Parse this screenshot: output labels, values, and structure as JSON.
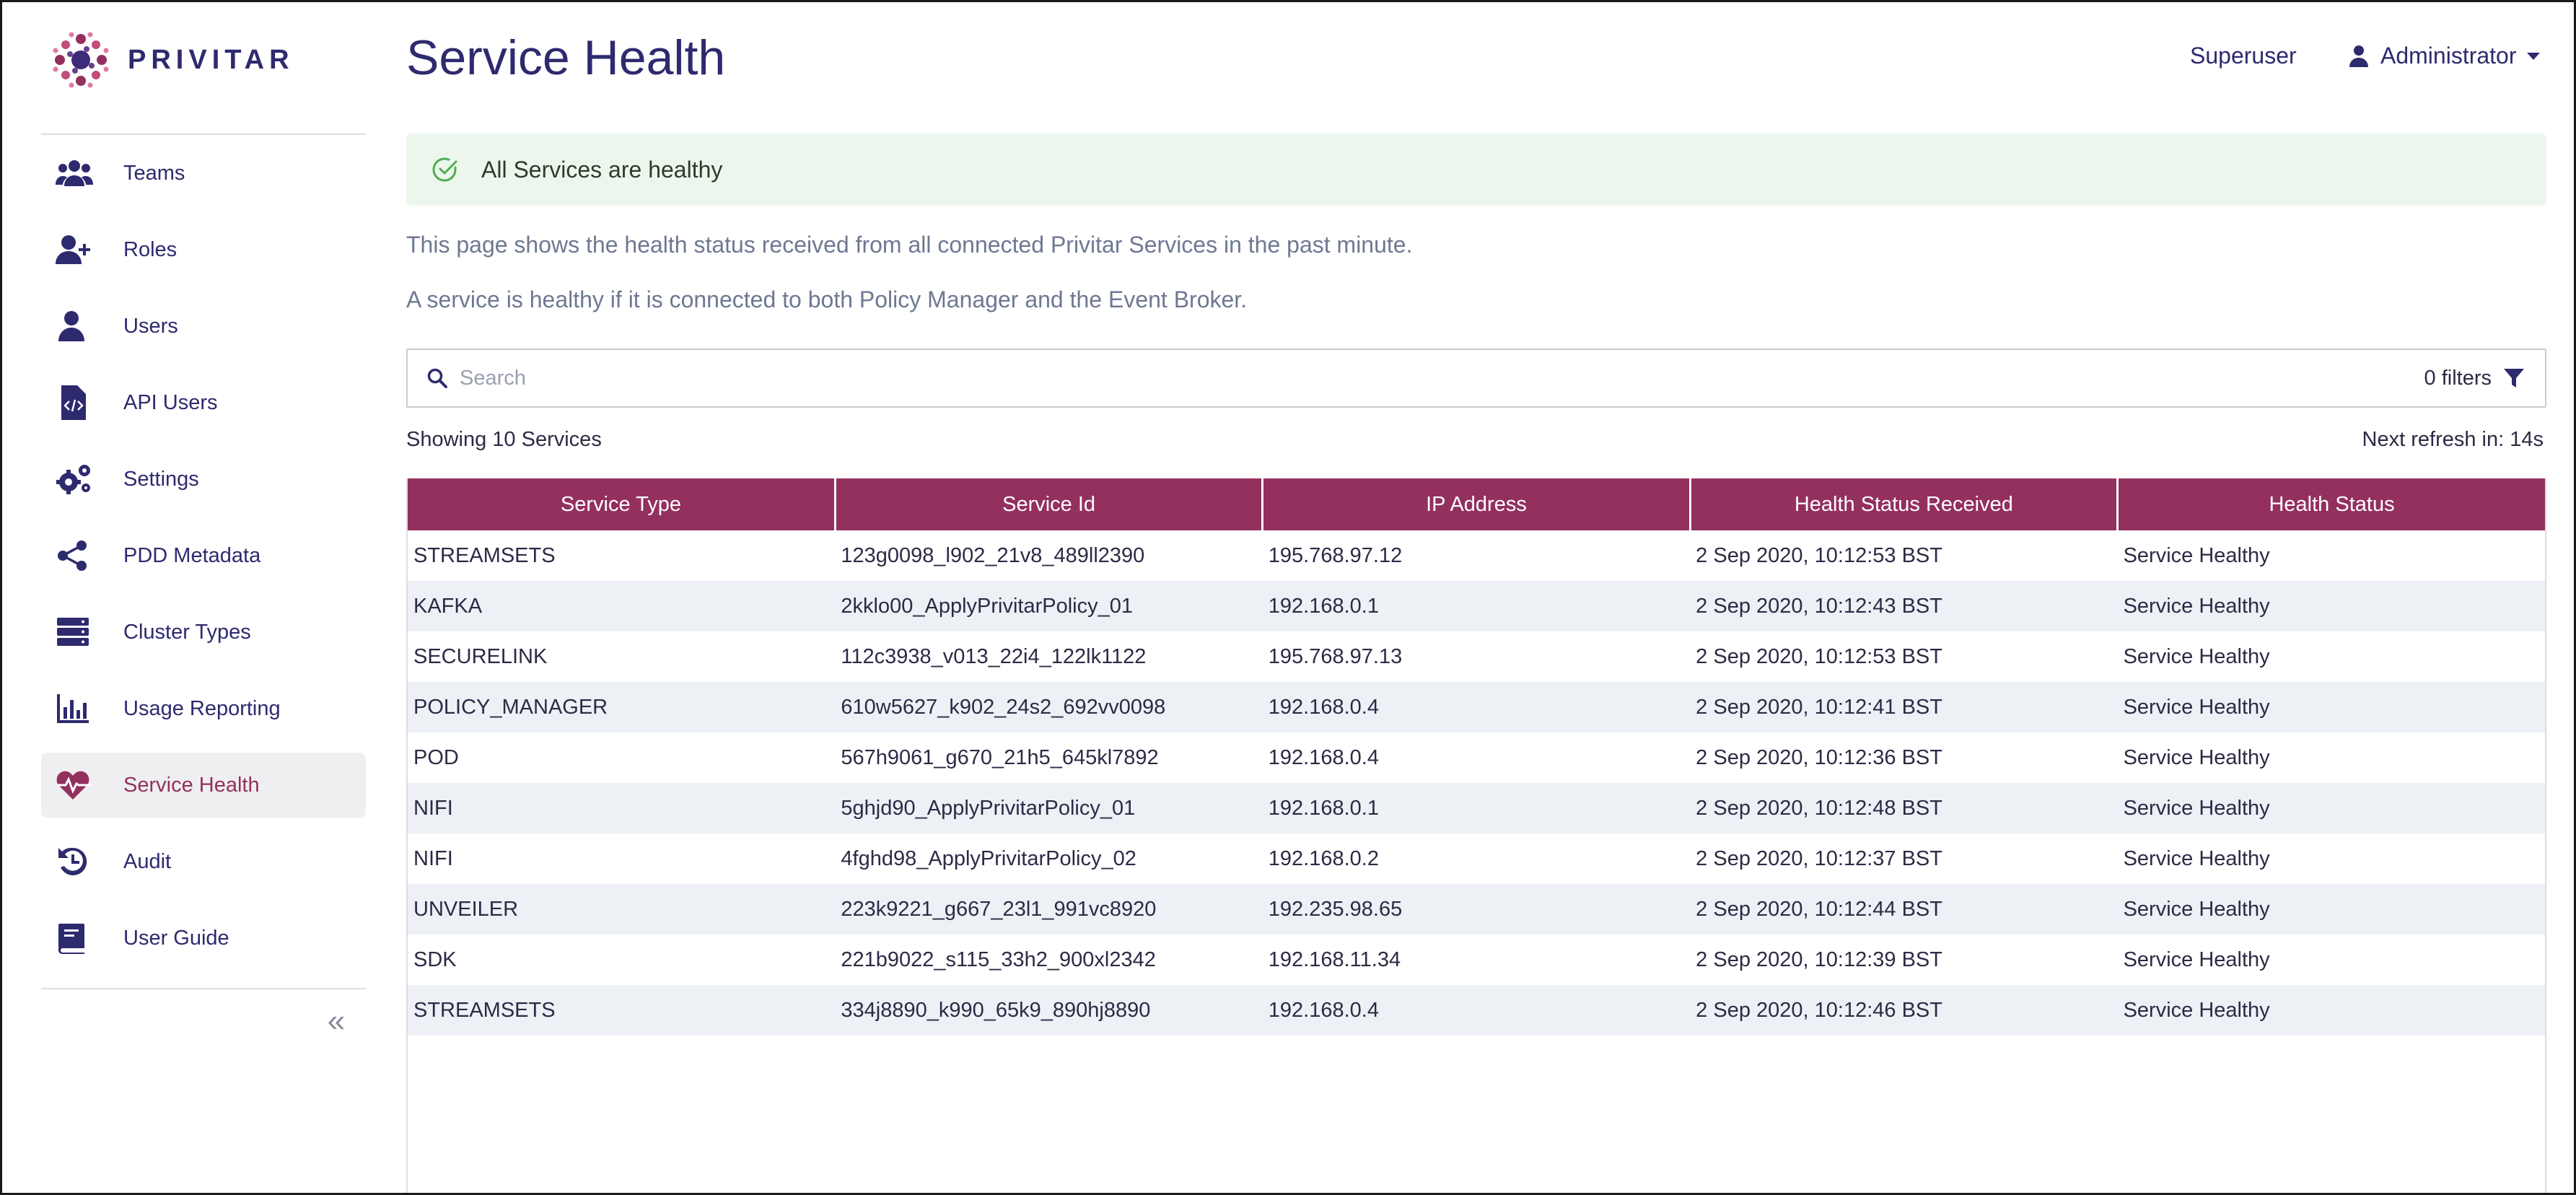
{
  "brand": {
    "name": "PRIVITAR"
  },
  "sidebar": {
    "items": [
      {
        "label": "Teams",
        "icon": "teams-icon",
        "active": false
      },
      {
        "label": "Roles",
        "icon": "add-user-icon",
        "active": false
      },
      {
        "label": "Users",
        "icon": "user-icon",
        "active": false
      },
      {
        "label": "API Users",
        "icon": "code-file-icon",
        "active": false
      },
      {
        "label": "Settings",
        "icon": "gears-icon",
        "active": false
      },
      {
        "label": "PDD Metadata",
        "icon": "share-icon",
        "active": false
      },
      {
        "label": "Cluster Types",
        "icon": "server-icon",
        "active": false
      },
      {
        "label": "Usage Reporting",
        "icon": "bar-chart-icon",
        "active": false
      },
      {
        "label": "Service Health",
        "icon": "heartbeat-icon",
        "active": true
      },
      {
        "label": "Audit",
        "icon": "history-icon",
        "active": false
      },
      {
        "label": "User Guide",
        "icon": "book-icon",
        "active": false
      }
    ],
    "collapse_icon": "double-chevron-left-icon"
  },
  "header": {
    "title": "Service Health",
    "role": "Superuser",
    "user": "Administrator"
  },
  "alert": {
    "text": "All Services are healthy",
    "color": "#4caf50"
  },
  "description": {
    "line1": "This page shows the health status received from all connected Privitar Services in the past minute.",
    "line2": "A service is healthy if it is connected to both Policy Manager and the Event Broker."
  },
  "search": {
    "placeholder": "Search",
    "filters_label": "0 filters"
  },
  "summary": {
    "showing": "Showing 10 Services",
    "refresh": "Next refresh in: 14s"
  },
  "table": {
    "columns": [
      "Service Type",
      "Service Id",
      "IP Address",
      "Health Status Received",
      "Health Status"
    ],
    "rows": [
      [
        "STREAMSETS",
        "123g0098_l902_21v8_489ll2390",
        "195.768.97.12",
        "2 Sep 2020, 10:12:53 BST",
        "Service Healthy"
      ],
      [
        "KAFKA",
        "2kklo00_ApplyPrivitarPolicy_01",
        "192.168.0.1",
        "2 Sep 2020, 10:12:43 BST",
        "Service Healthy"
      ],
      [
        "SECURELINK",
        "112c3938_v013_22i4_122lk1122",
        "195.768.97.13",
        "2 Sep 2020, 10:12:53 BST",
        "Service Healthy"
      ],
      [
        "POLICY_MANAGER",
        "610w5627_k902_24s2_692vv0098",
        "192.168.0.4",
        "2 Sep 2020, 10:12:41 BST",
        "Service Healthy"
      ],
      [
        "POD",
        "567h9061_g670_21h5_645kl7892",
        "192.168.0.4",
        "2 Sep 2020, 10:12:36 BST",
        "Service Healthy"
      ],
      [
        "NIFI",
        "5ghjd90_ApplyPrivitarPolicy_01",
        "192.168.0.1",
        "2 Sep 2020, 10:12:48 BST",
        "Service Healthy"
      ],
      [
        "NIFI",
        "4fghd98_ApplyPrivitarPolicy_02",
        "192.168.0.2",
        "2 Sep 2020, 10:12:37 BST",
        "Service Healthy"
      ],
      [
        "UNVEILER",
        "223k9221_g667_23l1_991vc8920",
        "192.235.98.65",
        "2 Sep 2020, 10:12:44 BST",
        "Service Healthy"
      ],
      [
        "SDK",
        "221b9022_s115_33h2_900xl2342",
        "192.168.11.34",
        "2 Sep 2020, 10:12:39 BST",
        "Service Healthy"
      ],
      [
        "STREAMSETS",
        "334j8890_k990_65k9_890hj8890",
        "192.168.0.4",
        "2 Sep 2020, 10:12:46 BST",
        "Service Healthy"
      ]
    ]
  },
  "colors": {
    "accent": "#93305e",
    "navy": "#2e2a6e",
    "row_alt": "#edf0f5"
  }
}
